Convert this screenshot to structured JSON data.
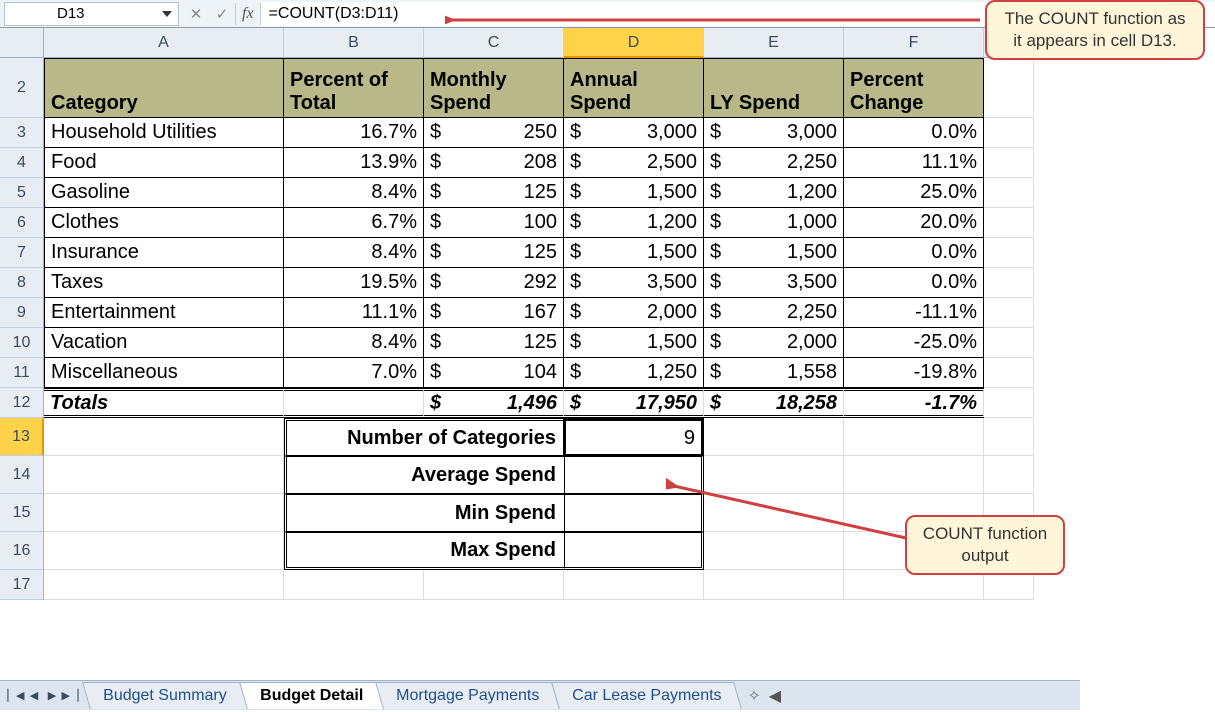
{
  "name_box": "D13",
  "fx_label": "fx",
  "formula": "=COUNT(D3:D11)",
  "col_headers": [
    "A",
    "B",
    "C",
    "D",
    "E",
    "F"
  ],
  "selected_col": "D",
  "selected_row": 13,
  "headers": {
    "A": "Category",
    "B": "Percent of Total",
    "C": "Monthly Spend",
    "D": "Annual Spend",
    "E": "LY Spend",
    "F": "Percent Change"
  },
  "rows": [
    {
      "n": 3,
      "cat": "Household Utilities",
      "pct": "16.7%",
      "mon": "250",
      "ann": "3,000",
      "ly": "3,000",
      "chg": "0.0%"
    },
    {
      "n": 4,
      "cat": "Food",
      "pct": "13.9%",
      "mon": "208",
      "ann": "2,500",
      "ly": "2,250",
      "chg": "11.1%"
    },
    {
      "n": 5,
      "cat": "Gasoline",
      "pct": "8.4%",
      "mon": "125",
      "ann": "1,500",
      "ly": "1,200",
      "chg": "25.0%"
    },
    {
      "n": 6,
      "cat": "Clothes",
      "pct": "6.7%",
      "mon": "100",
      "ann": "1,200",
      "ly": "1,000",
      "chg": "20.0%"
    },
    {
      "n": 7,
      "cat": "Insurance",
      "pct": "8.4%",
      "mon": "125",
      "ann": "1,500",
      "ly": "1,500",
      "chg": "0.0%"
    },
    {
      "n": 8,
      "cat": "Taxes",
      "pct": "19.5%",
      "mon": "292",
      "ann": "3,500",
      "ly": "3,500",
      "chg": "0.0%"
    },
    {
      "n": 9,
      "cat": "Entertainment",
      "pct": "11.1%",
      "mon": "167",
      "ann": "2,000",
      "ly": "2,250",
      "chg": "-11.1%"
    },
    {
      "n": 10,
      "cat": "Vacation",
      "pct": "8.4%",
      "mon": "125",
      "ann": "1,500",
      "ly": "2,000",
      "chg": "-25.0%"
    },
    {
      "n": 11,
      "cat": "Miscellaneous",
      "pct": "7.0%",
      "mon": "104",
      "ann": "1,250",
      "ly": "1,558",
      "chg": "-19.8%"
    }
  ],
  "totals": {
    "label": "Totals",
    "mon": "1,496",
    "ann": "17,950",
    "ly": "18,258",
    "chg": "-1.7%"
  },
  "stats": [
    {
      "n": 13,
      "label": "Number of Categories",
      "val": "9"
    },
    {
      "n": 14,
      "label": "Average Spend",
      "val": ""
    },
    {
      "n": 15,
      "label": "Min Spend",
      "val": ""
    },
    {
      "n": 16,
      "label": "Max Spend",
      "val": ""
    }
  ],
  "row17": 17,
  "tabs": [
    "Budget Summary",
    "Budget Detail",
    "Mortgage Payments",
    "Car Lease Payments"
  ],
  "active_tab": 1,
  "callout1": "The COUNT function as it appears in cell D13.",
  "callout2": "COUNT function output"
}
